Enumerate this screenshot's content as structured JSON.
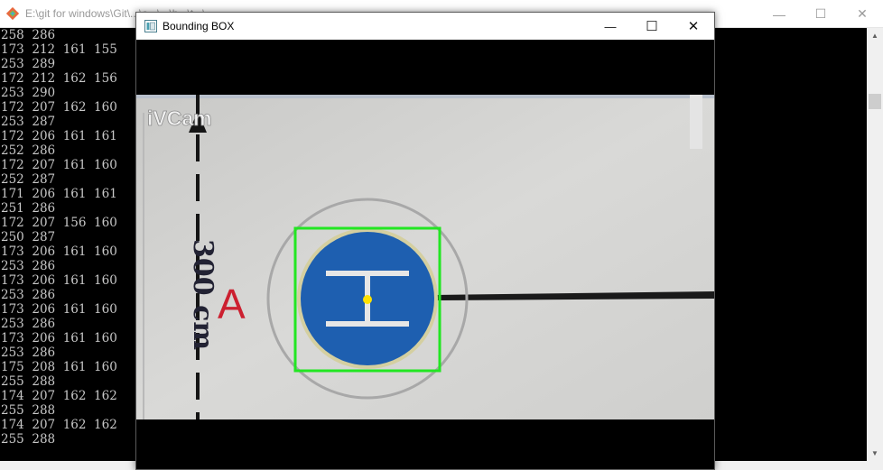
{
  "console": {
    "title": "E:\\git for windows\\Git\\...\\a...\\...\\h...\\t...\\...",
    "minimize": "—",
    "maximize": "☐",
    "close": "✕",
    "lines": [
      "258  286",
      "173  212  161  155",
      "253  289",
      "172  212  162  156",
      "253  290",
      "172  207  162  160",
      "253  287",
      "172  206  161  161",
      "252  286",
      "172  207  161  160",
      "252  287",
      "171  206  161  161",
      "251  286",
      "172  207  156  160",
      "250  287",
      "173  206  161  160",
      "253  286",
      "173  206  161  160",
      "253  286",
      "173  206  161  160",
      "253  286",
      "173  206  161  160",
      "253  286",
      "175  208  161  160",
      "255  288",
      "174  207  162  162",
      "255  288",
      "174  207  162  162",
      "255  288"
    ]
  },
  "bbox_window": {
    "title": "Bounding BOX",
    "minimize": "—",
    "maximize": "☐",
    "close": "✕"
  },
  "camera": {
    "watermark": "iVCam",
    "ruler_label": "300 cm",
    "marker_letter": "A",
    "helipad_letter": "H",
    "box_color": "#22e622",
    "center_color": "#ffe100",
    "pad_color": "#1e5fb0"
  }
}
